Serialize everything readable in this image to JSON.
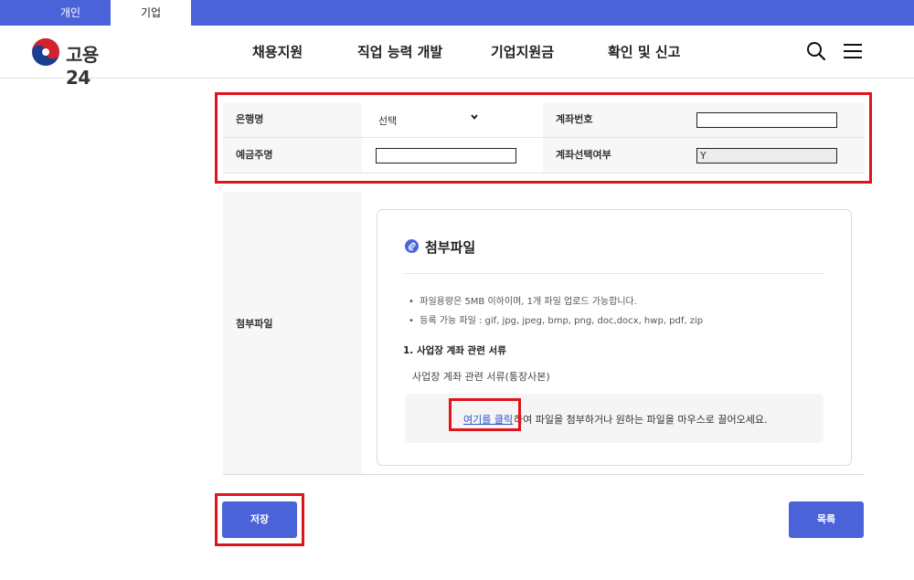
{
  "top_tabs": [
    {
      "label": "개인",
      "active": false
    },
    {
      "label": "기업",
      "active": true
    }
  ],
  "header": {
    "logo_text": "고용24",
    "nav": [
      "채용지원",
      "직업 능력 개발",
      "기업지원금",
      "확인 및 신고"
    ],
    "icons": [
      "search-icon",
      "hamburger-menu-icon"
    ]
  },
  "form": {
    "bank_label": "은행명",
    "bank_value": "선택",
    "account_label": "계좌번호",
    "account_value": "",
    "holder_label": "예금주명",
    "holder_value": "",
    "account_select_label": "계좌선택여부",
    "account_select_value": "Y"
  },
  "attachment": {
    "row_label": "첨부파일",
    "title": "첨부파일",
    "notes": [
      "파일용량은 5MB 이하이며, 1개 파일 업로드 가능합니다.",
      "등록 가능 파일 : gif, jpg, jpeg, bmp, png, doc,docx, hwp, pdf, zip"
    ],
    "section_title": "1. 사업장 계좌 관련 서류",
    "section_desc": "사업장 계좌 관련 서류(통장사본)",
    "drop_link": "여기를 클릭",
    "drop_text": "하여 파일을 첨부하거나 원하는 파일을 마우스로 끌어오세요."
  },
  "buttons": {
    "save": "저장",
    "list": "목록"
  },
  "colors": {
    "accent": "#4b63d8",
    "highlight": "#e0141c",
    "link": "#2a52c8"
  }
}
